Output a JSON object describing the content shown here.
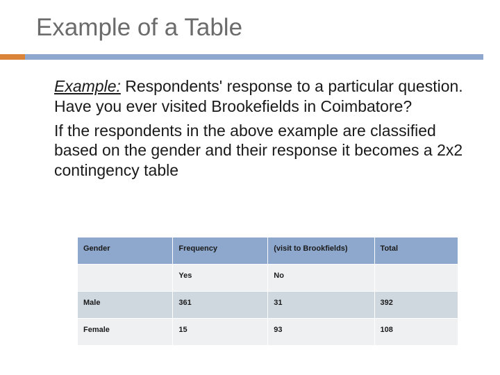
{
  "title": "Example of a Table",
  "paragraph1_label": "Example:",
  "paragraph1_rest": " Respondents' response to a particular question. Have you ever visited Brookefields in Coimbatore?",
  "paragraph2": "If the respondents in the above example are classified based on the gender and their response it becomes a 2x2 contingency table",
  "table": {
    "headers": {
      "gender": "Gender",
      "frequency": "Frequency",
      "visit": "(visit to Brookfields)",
      "total": "Total"
    },
    "subheaders": {
      "yes": "Yes",
      "no": "No"
    },
    "rows": [
      {
        "gender": "Male",
        "yes": "361",
        "no": "31",
        "total": "392"
      },
      {
        "gender": "Female",
        "yes": "15",
        "no": "93",
        "total": "108"
      }
    ]
  },
  "chart_data": {
    "type": "table",
    "title": "2x2 contingency table — visit to Brookfields by Gender",
    "columns": [
      "Gender",
      "Yes",
      "No",
      "Total"
    ],
    "rows": [
      [
        "Male",
        361,
        31,
        392
      ],
      [
        "Female",
        15,
        93,
        108
      ]
    ]
  }
}
